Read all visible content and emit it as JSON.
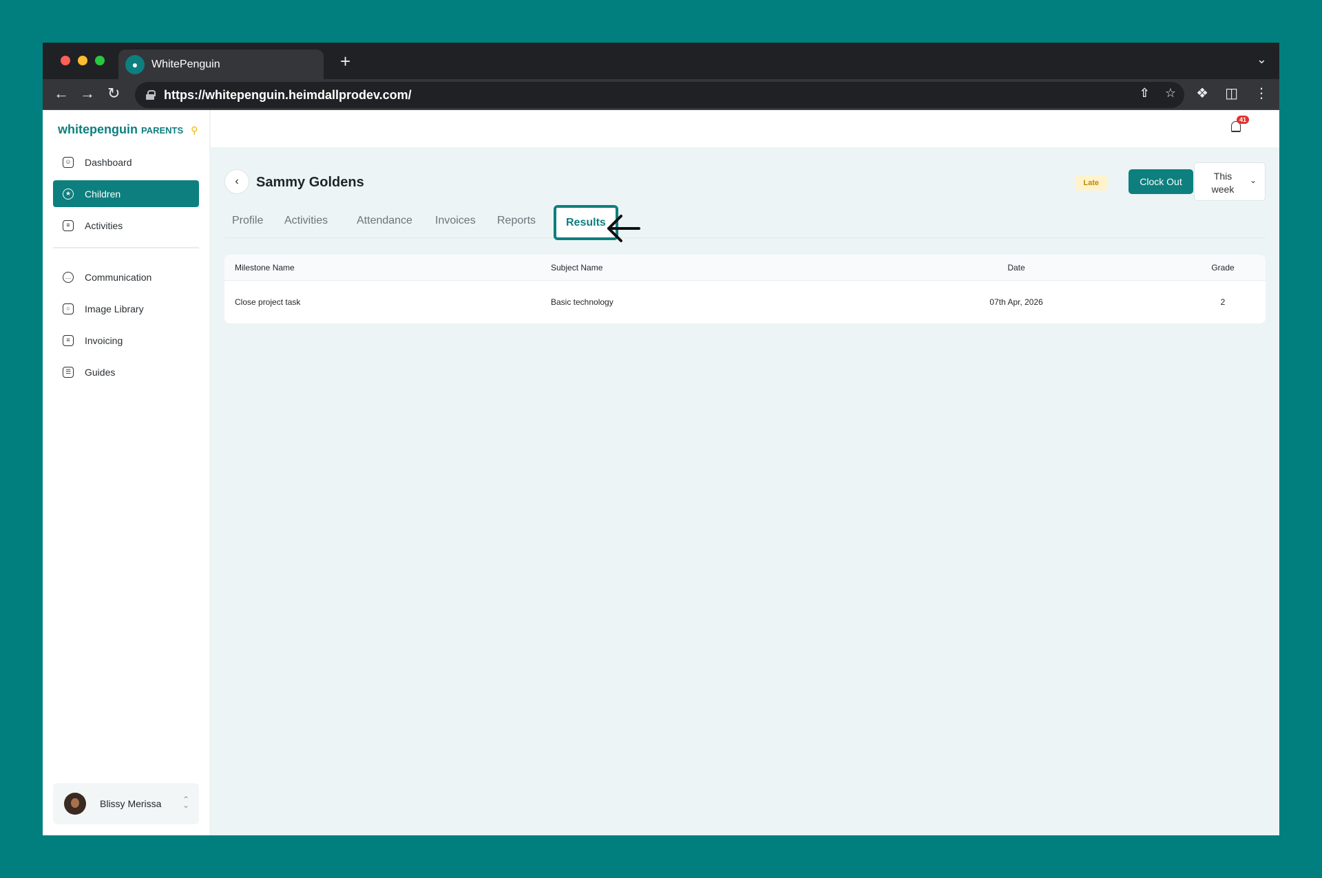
{
  "browser": {
    "tab_title": "WhitePenguin",
    "url": "https://whitepenguin.heimdallprodev.com/"
  },
  "sidebar": {
    "logo_main": "whitepenguin",
    "logo_sub": "PARENTS",
    "items": [
      {
        "label": "Dashboard",
        "icon": "dashboard-icon"
      },
      {
        "label": "Children",
        "icon": "children-icon",
        "active": true
      },
      {
        "label": "Activities",
        "icon": "clipboard-icon"
      },
      {
        "label": "Communication",
        "icon": "chat-icon"
      },
      {
        "label": "Image Library",
        "icon": "camera-icon"
      },
      {
        "label": "Invoicing",
        "icon": "invoice-icon"
      },
      {
        "label": "Guides",
        "icon": "guide-icon"
      }
    ],
    "user": {
      "name": "Blissy Merissa"
    }
  },
  "topbar": {
    "notification_count": "41"
  },
  "header": {
    "child_name": "Sammy Goldens",
    "status_badge": "Late",
    "clock_button": "Clock Out",
    "period_line1": "This",
    "period_line2": "week"
  },
  "tabs": [
    "Profile",
    "Activities",
    "Attendance",
    "Invoices",
    "Reports",
    "Results"
  ],
  "results_table": {
    "columns": [
      "Milestone Name",
      "Subject Name",
      "Date",
      "Grade"
    ],
    "rows": [
      [
        "Close project task",
        "Basic technology",
        "07th Apr, 2026",
        "2"
      ]
    ]
  },
  "colors": {
    "brand": "#0d7f7e",
    "background": "#007f7e",
    "late_badge": "#fff3cd"
  }
}
